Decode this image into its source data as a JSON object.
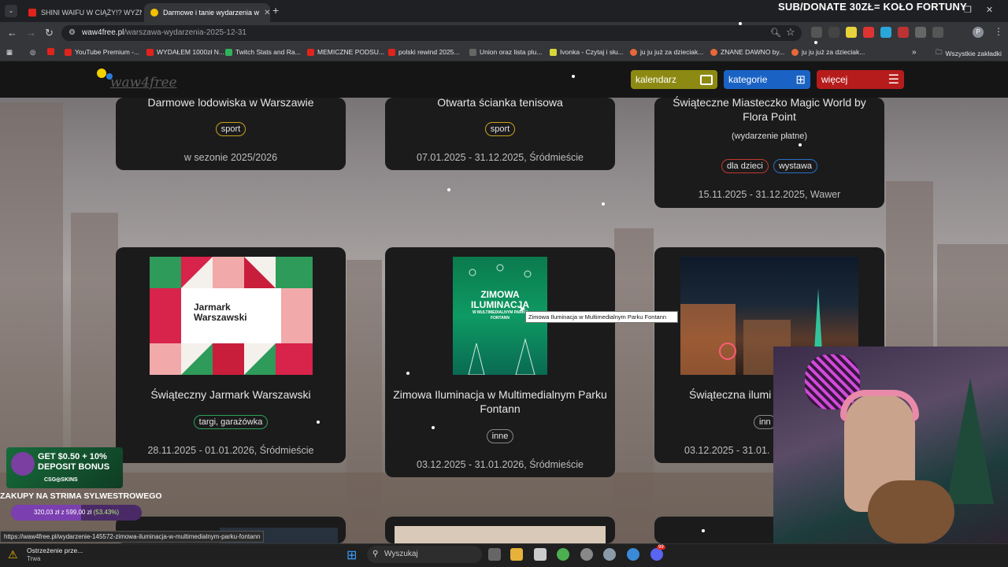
{
  "browser": {
    "tabs": [
      {
        "title": "SHINI WAIFU W CIĄŻY!? WYZN",
        "favicon_color": "#e0241b"
      },
      {
        "title": "Darmowe i tanie wydarzenia w",
        "favicon_color": "#f2c200"
      }
    ],
    "url_host": "waw4free.pl",
    "url_path": "/warszawa-wydarzenia-2025-12-31",
    "bookmarks": [
      {
        "label": "YouTube Premium -...",
        "color": "#e0241b"
      },
      {
        "label": "WYDAŁEM 1000zł N...",
        "color": "#e0241b"
      },
      {
        "label": "Twitch Stats and Ra...",
        "color": "#2fb35c"
      },
      {
        "label": "MEMICZNE PODSU...",
        "color": "#e0241b"
      },
      {
        "label": "polski rewind 2025...",
        "color": "#e0241b"
      },
      {
        "label": "Union oraz lista plu...",
        "color": "#888888"
      },
      {
        "label": "Ivonka - Czytaj i słu...",
        "color": "#d6d63a"
      },
      {
        "label": "ju ju już za dzieciak...",
        "color": "#e8683a"
      },
      {
        "label": "ZNANE DAWNO by...",
        "color": "#e8683a"
      },
      {
        "label": "ju ju już za dzieciak...",
        "color": "#e8683a"
      }
    ],
    "all_bookmarks": "Wszystkie zakładki"
  },
  "stream_overlay": {
    "top_text": "SUB/DONATE 30ZŁ= KOŁO FORTUNY",
    "promo_line1": "GET $0.50 + 10%",
    "promo_line2": "DEPOSIT BONUS",
    "promo_brand": "CSG◎SKINS",
    "goal_title": "ZAKUPY NA STRIMA SYLWESTROWEGO",
    "goal_progress": "320,03 zł z 599,00 zł",
    "goal_percent": "(53.43%)",
    "goal_fraction": 0.5343
  },
  "site": {
    "logo": "waw4free",
    "nav": {
      "calendar": "kalendarz",
      "categories": "kategorie",
      "more": "więcej"
    },
    "cards_row1": [
      {
        "title": "Darmowe lodowiska w Warszawie",
        "tags": [
          "sport"
        ],
        "date": "w sezonie 2025/2026"
      },
      {
        "title": "Otwarta ścianka tenisowa",
        "tags": [
          "sport"
        ],
        "date": "07.01.2025 - 31.12.2025, Śródmieście"
      },
      {
        "title": "Świąteczne Miasteczko Magic World by Flora Point",
        "note": "(wydarzenie płatne)",
        "tags": [
          "dla dzieci",
          "wystawa"
        ],
        "date": "15.11.2025 - 31.12.2025, Wawer"
      }
    ],
    "cards_row2": [
      {
        "title": "Świąteczny Jarmark Warszawski",
        "image_text_1": "Jarmark",
        "image_text_2": "Warszawski",
        "tags": [
          "targi, garażówka"
        ],
        "date": "28.11.2025 - 01.01.2026, Śródmieście"
      },
      {
        "title": "Zimowa Iluminacja w Multimedialnym Parku Fontann",
        "image_text_1": "ZIMOWA",
        "image_text_2": "ILUMINACJA",
        "image_text_3": "W MULTIMEDIALNYM PARKU FONTANN",
        "tags": [
          "inne"
        ],
        "date": "03.12.2025 - 31.01.2026, Śródmieście"
      },
      {
        "title": "Świąteczna ilumi",
        "tags": [
          "inn"
        ],
        "date": "03.12.2025 - 31.01."
      }
    ],
    "tooltip": "Zimowa Iluminacja w Multimedialnym Parku Fontann",
    "status_url": "https://waw4free.pl/wydarzenie-145572-zimowa-iluminacja-w-multimedialnym-parku-fontann"
  },
  "taskbar": {
    "warning_title": "Ostrzeżenie prze...",
    "warning_sub": "Trwa",
    "search_placeholder": "Wyszukaj",
    "discord_badge": "99"
  }
}
